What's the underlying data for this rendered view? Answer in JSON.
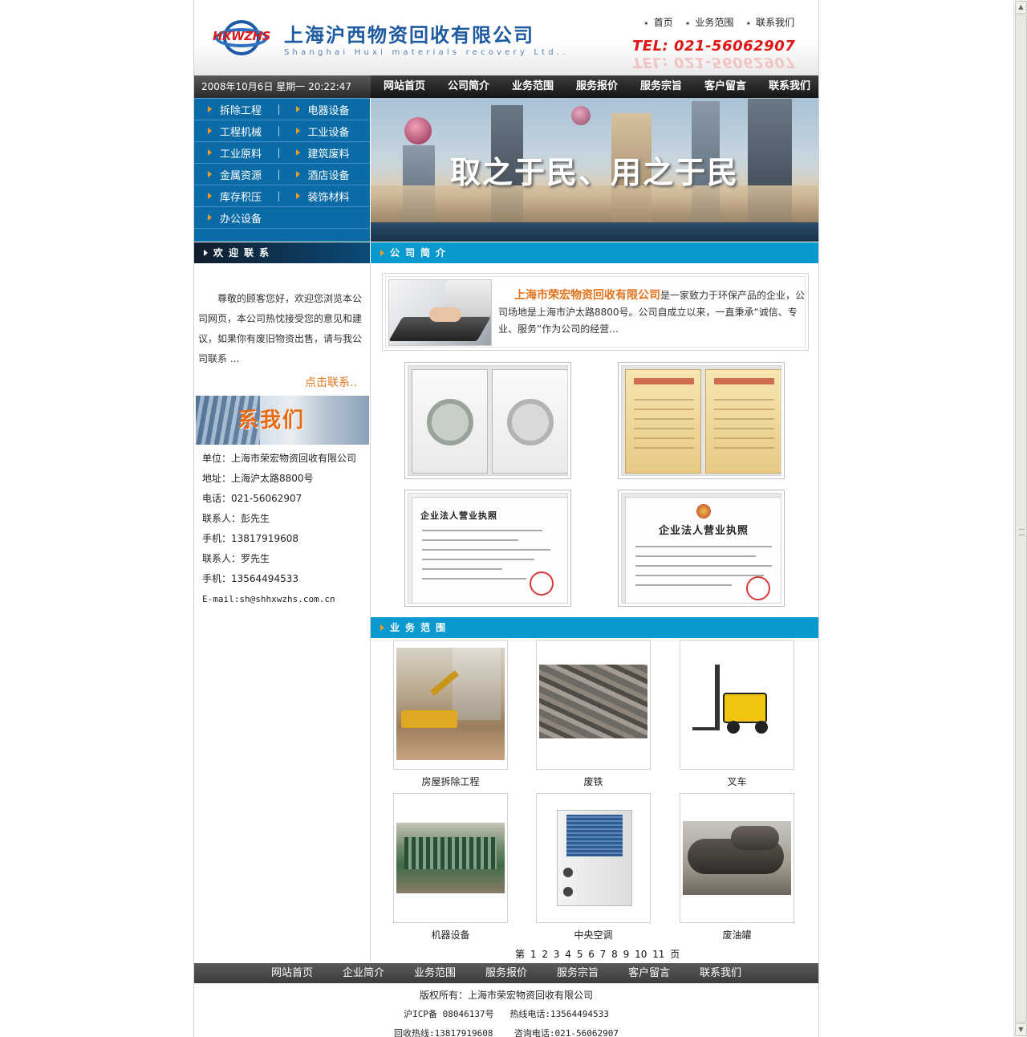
{
  "header": {
    "logo_text": "HXWZHS",
    "company_cn": "上海沪西物资回收有限公司",
    "company_en": "Shanghai Huxi materials recovery Ltd..",
    "top_links": [
      "首页",
      "业务范围",
      "联系我们"
    ],
    "tel": "TEL: 021-56062907"
  },
  "navbar": {
    "datetime": "2008年10月6日 星期一 20:22:47",
    "items": [
      "网站首页",
      "公司简介",
      "业务范围",
      "服务报价",
      "服务宗旨",
      "客户留言",
      "联系我们"
    ]
  },
  "categories": [
    [
      "拆除工程",
      "电器设备"
    ],
    [
      "工程机械",
      "工业设备"
    ],
    [
      "工业原料",
      "建筑废料"
    ],
    [
      "金属资源",
      "酒店设备"
    ],
    [
      "库存积压",
      "装饰材料"
    ],
    [
      "办公设备"
    ]
  ],
  "banner": {
    "slogan": "取之于民、用之于民"
  },
  "sections": {
    "welcome": "欢迎联系",
    "about": "公司简介",
    "business": "业务范围"
  },
  "welcome": {
    "text": "尊敬的顾客您好，欢迎您浏览本公司网页，本公司热忱接受您的意见和建议，如果你有废旧物资出售，请与我公司联系 ...",
    "more": "点击联系..",
    "contact_image_title": "系我们"
  },
  "contact": {
    "unit": "单位：上海市荣宏物资回收有限公司",
    "address": "地址：上海沪太路8800号",
    "phone": "电话：021-56062907",
    "contact1": "联系人：彭先生",
    "mobile1": "手机：13817919608",
    "contact2": "联系人：罗先生",
    "mobile2": "手机：13564494533",
    "email": "E-mail:sh@shhxwzhs.com.cn"
  },
  "intro": {
    "company": "上海市荣宏物资回收有限公司",
    "text": "是一家致力于环保产品的企业，公司场地是上海市沪太路8800号。公司自成立以来，一直秉承“诚信、专业、服务”作为公司的经营..."
  },
  "certificates": {
    "license_title": "企业法人营业执照"
  },
  "products": [
    "房屋拆除工程",
    "废铁",
    "叉车",
    "机器设备",
    "中央空调",
    "废油罐"
  ],
  "pager": {
    "prefix": "第",
    "pages": [
      "1",
      "2",
      "3",
      "4",
      "5",
      "6",
      "7",
      "8",
      "9",
      "10",
      "11"
    ],
    "suffix": "页"
  },
  "footer": {
    "nav": [
      "网站首页",
      "企业简介",
      "业务范围",
      "服务报价",
      "服务宗旨",
      "客户留言",
      "联系我们"
    ],
    "copyright": "版权所有：上海市荣宏物资回收有限公司",
    "icp": "沪ICP备 08046137号   热线电话:13564494533",
    "hotline": "回收热线:13817919608    咨询电话:021-56062907"
  },
  "colors": {
    "brand_blue": "#0b6ba7",
    "section_blue": "#0b9ad0",
    "accent_orange": "#e2731a",
    "tel_red": "#e01515"
  }
}
